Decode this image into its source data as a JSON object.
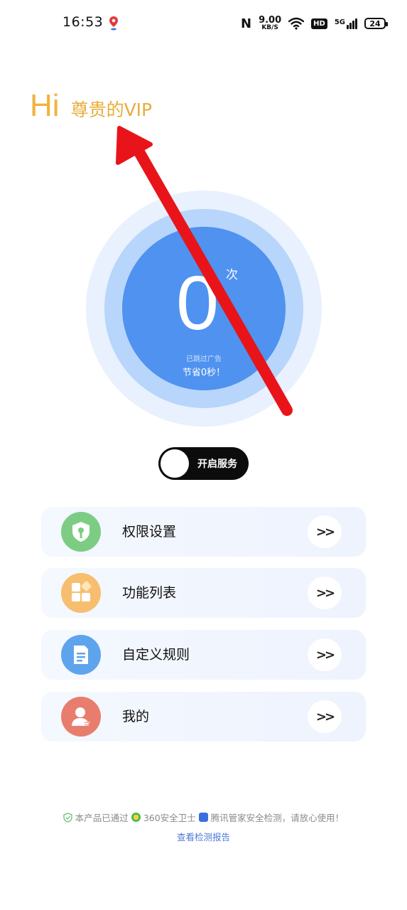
{
  "status_bar": {
    "time": "16:53",
    "nfc": "N",
    "speed_value": "9.00",
    "speed_unit": "KB/S",
    "hd": "HD",
    "network": "5G",
    "battery": "24"
  },
  "greeting": {
    "hi": "Hi",
    "name": "尊贵的VIP"
  },
  "counter": {
    "value": "0",
    "unit": "次",
    "caption": "已跳过广告",
    "saved": "节省0秒！"
  },
  "service_toggle": {
    "label": "开启服务",
    "on": false
  },
  "menu": {
    "items": [
      {
        "label": "权限设置",
        "icon": "shield-key-icon",
        "color": "#7ccd83"
      },
      {
        "label": "功能列表",
        "icon": "grid-blocks-icon",
        "color": "#f7be6f"
      },
      {
        "label": "自定义规则",
        "icon": "document-rule-icon",
        "color": "#5ea4ec"
      },
      {
        "label": "我的",
        "icon": "user-profile-icon",
        "color": "#e97d6d"
      }
    ],
    "chevron": ">>"
  },
  "footer": {
    "text_a": "本产品已通过",
    "text_b": "360安全卫士",
    "text_c": "腾讯管家安全检测，请放心使用！",
    "link": "查看检测报告"
  },
  "colors": {
    "accent_gold": "#f0b33c",
    "circle_blue": "#4f92ef",
    "annotation_arrow": "#e8141a",
    "link_blue": "#4d79d8"
  }
}
